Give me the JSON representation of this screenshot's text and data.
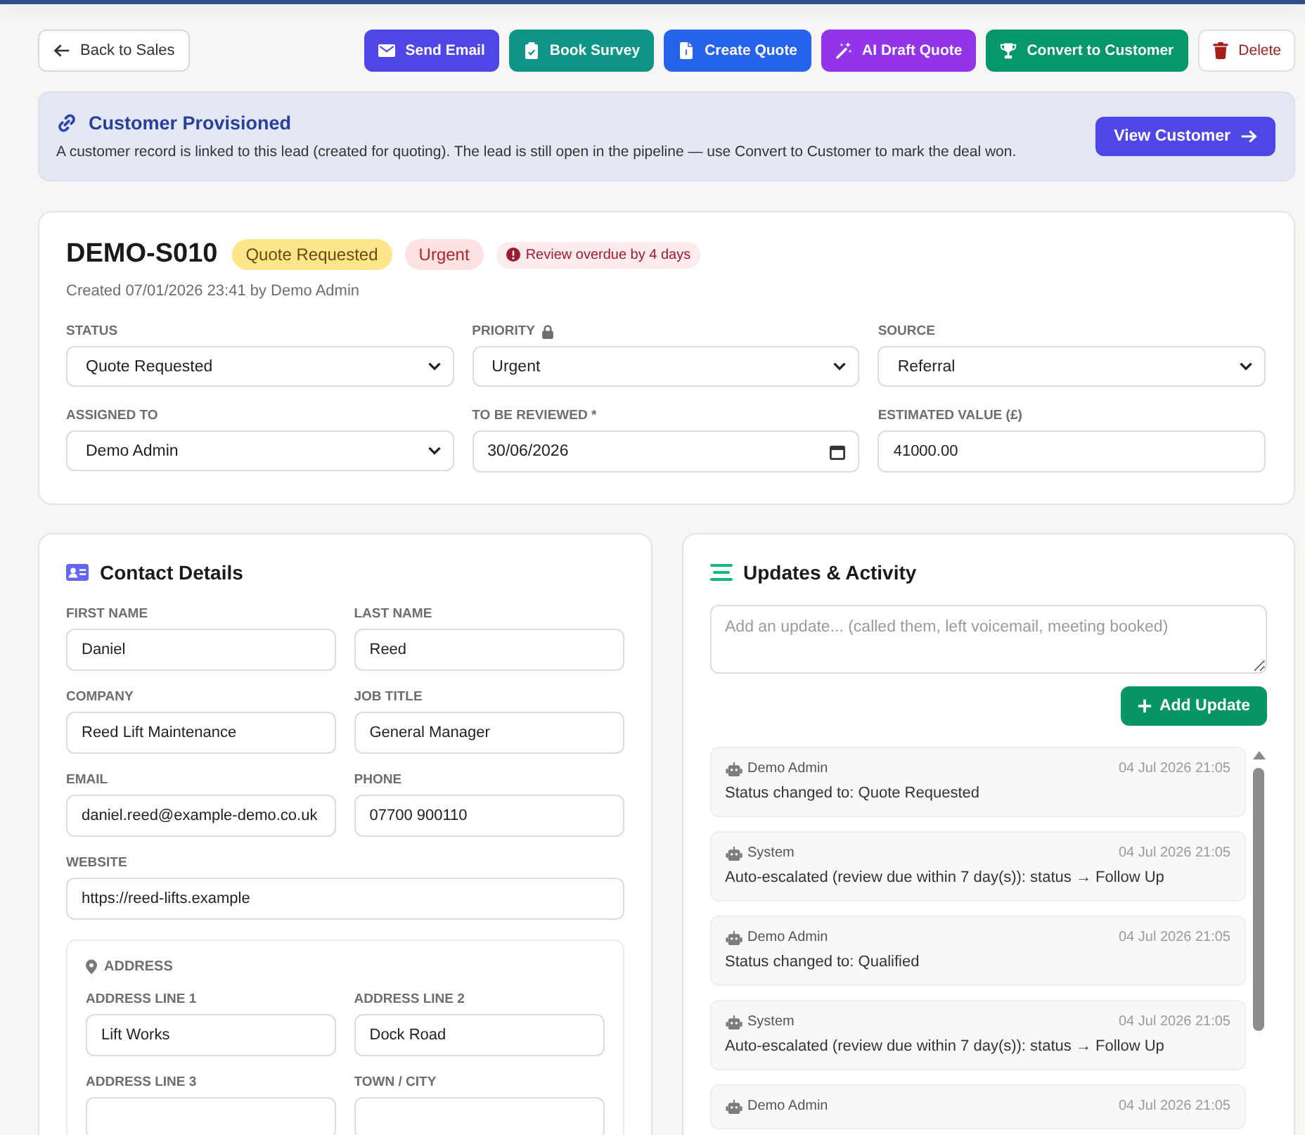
{
  "toolbar": {
    "back": "Back to Sales",
    "actions": [
      {
        "label": "Send Email",
        "kind": "email",
        "color": "#4f46e5"
      },
      {
        "label": "Book Survey",
        "kind": "survey",
        "color": "#0f9488"
      },
      {
        "label": "Create Quote",
        "kind": "quote",
        "color": "#2563eb"
      },
      {
        "label": "AI Draft Quote",
        "kind": "ai-draft",
        "color": "#9333ea"
      },
      {
        "label": "Convert to Customer",
        "kind": "convert",
        "color": "#059669"
      },
      {
        "label": "Delete",
        "kind": "delete",
        "color": "#a51d1d"
      }
    ]
  },
  "banner": {
    "title": "Customer Provisioned",
    "text": "A customer record is linked to this lead (created for quoting). The lead is still open in the pipeline — use Convert to Customer to mark the deal won.",
    "button": "View Customer"
  },
  "lead": {
    "code": "DEMO-S010",
    "badges": [
      {
        "label": "Quote Requested",
        "kind": "status"
      },
      {
        "label": "Urgent",
        "kind": "priority"
      },
      {
        "label": "Review overdue by 4 days",
        "kind": "alert"
      }
    ],
    "created": "Created 07/01/2026 23:41 by Demo Admin",
    "fields": [
      {
        "label": "STATUS",
        "kind": "select",
        "value": "Quote Requested",
        "locked": false
      },
      {
        "label": "PRIORITY",
        "kind": "select",
        "value": "Urgent",
        "locked": true
      },
      {
        "label": "SOURCE",
        "kind": "select",
        "value": "Referral",
        "locked": false
      },
      {
        "label": "ASSIGNED TO",
        "kind": "select",
        "value": "Demo Admin",
        "locked": false
      },
      {
        "label": "TO BE REVIEWED *",
        "kind": "date",
        "value": "30/06/2026",
        "locked": false
      },
      {
        "label": "ESTIMATED VALUE (£)",
        "kind": "text",
        "value": "41000.00",
        "locked": false
      }
    ]
  },
  "contact": {
    "title": "Contact Details",
    "fields": [
      {
        "label": "FIRST NAME",
        "value": "Daniel"
      },
      {
        "label": "LAST NAME",
        "value": "Reed"
      },
      {
        "label": "COMPANY",
        "value": "Reed Lift Maintenance"
      },
      {
        "label": "JOB TITLE",
        "value": "General Manager"
      },
      {
        "label": "EMAIL",
        "value": "daniel.reed@example-demo.co.uk"
      },
      {
        "label": "PHONE",
        "value": "07700 900110"
      }
    ],
    "website": {
      "label": "WEBSITE",
      "value": "https://reed-lifts.example"
    },
    "address": {
      "title": "ADDRESS",
      "fields": [
        {
          "label": "ADDRESS LINE 1",
          "value": "Lift Works"
        },
        {
          "label": "ADDRESS LINE 2",
          "value": "Dock Road"
        },
        {
          "label": "ADDRESS LINE 3"
        },
        {
          "label": "TOWN / CITY"
        }
      ]
    }
  },
  "activity": {
    "title": "Updates & Activity",
    "placeholder": "Add an update... (called them, left voicemail, meeting booked)",
    "button": "Add Update",
    "entries": [
      {
        "author": "Demo Admin",
        "time": "04 Jul 2026 21:05",
        "text": "Status changed to: Quote Requested"
      },
      {
        "author": "System",
        "time": "04 Jul 2026 21:05",
        "text": "Auto-escalated (review due within 7 day(s)): status → Follow Up"
      },
      {
        "author": "Demo Admin",
        "time": "04 Jul 2026 21:05",
        "text": "Status changed to: Qualified"
      },
      {
        "author": "System",
        "time": "04 Jul 2026 21:05",
        "text": "Auto-escalated (review due within 7 day(s)): status → Follow Up"
      },
      {
        "author": "Demo Admin",
        "time": "04 Jul 2026 21:05"
      }
    ]
  }
}
